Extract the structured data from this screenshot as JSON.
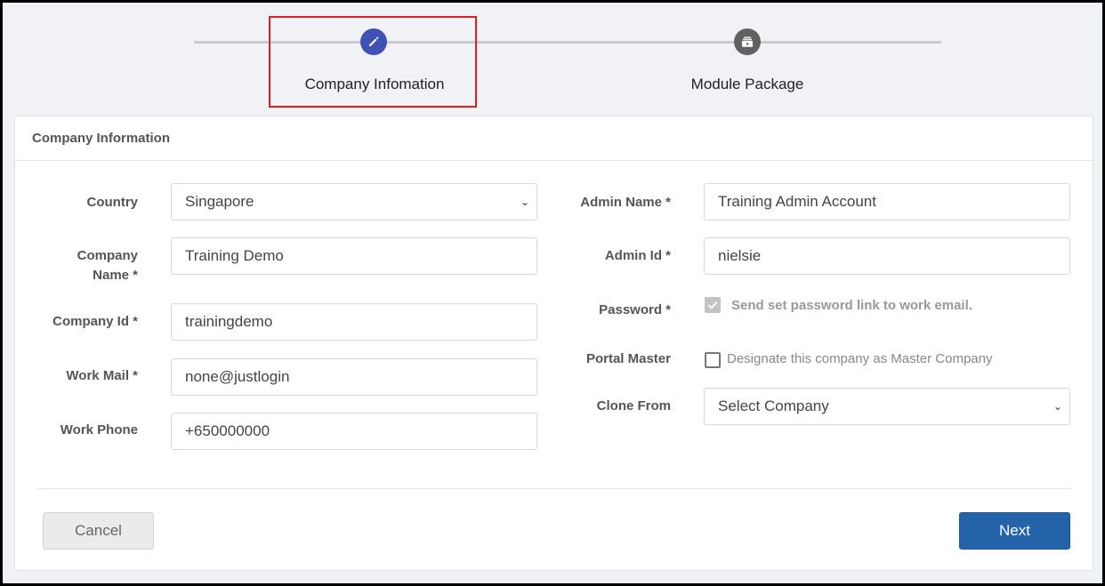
{
  "stepper": {
    "steps": [
      {
        "label": "Company Infomation",
        "icon": "pencil-icon",
        "state": "active"
      },
      {
        "label": "Module Package",
        "icon": "package-icon",
        "state": "inactive"
      }
    ],
    "active_color": "#3f51b5",
    "inactive_color": "#616161"
  },
  "card": {
    "title": "Company Information"
  },
  "left": {
    "country": {
      "label": "Country",
      "value": "Singapore"
    },
    "company_name": {
      "label_line1": "Company",
      "label_line2": "Name *",
      "value": "Training Demo"
    },
    "company_id": {
      "label": "Company Id *",
      "value": "trainingdemo"
    },
    "work_mail": {
      "label": "Work Mail *",
      "value": "none@justlogin"
    },
    "work_phone": {
      "label": "Work Phone",
      "value": "+650000000"
    }
  },
  "right": {
    "admin_name": {
      "label": "Admin Name *",
      "value": "Training Admin Account"
    },
    "admin_id": {
      "label": "Admin Id *",
      "value": "nielsie"
    },
    "password": {
      "label": "Password *",
      "checkbox_text": "Send set password link to work email.",
      "checked": true
    },
    "portal_master": {
      "label": "Portal Master",
      "checkbox_text": "Designate this company as Master Company",
      "checked": false
    },
    "clone_from": {
      "label": "Clone From",
      "value": "Select Company"
    }
  },
  "actions": {
    "cancel_label": "Cancel",
    "next_label": "Next",
    "next_color": "#2563a8"
  }
}
